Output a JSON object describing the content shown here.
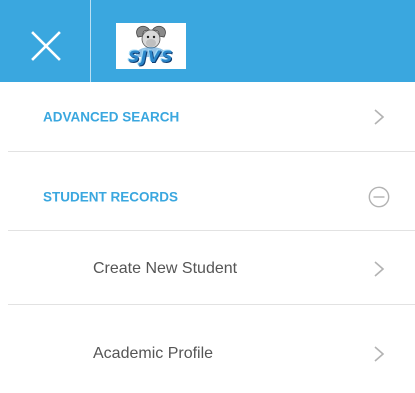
{
  "header": {
    "close_icon": "close-icon",
    "logo_text": "SJVS",
    "background_color": "#3aa7df"
  },
  "menu": {
    "advanced_search": {
      "label": "ADVANCED SEARCH",
      "indicator": "chevron-right-icon"
    },
    "student_records": {
      "label": "STUDENT RECORDS",
      "indicator": "collapse-minus-icon",
      "expanded": true
    },
    "sub_items": [
      {
        "label": "Create New Student",
        "indicator": "chevron-right-icon"
      },
      {
        "label": "Academic Profile",
        "indicator": "chevron-right-icon"
      }
    ]
  }
}
